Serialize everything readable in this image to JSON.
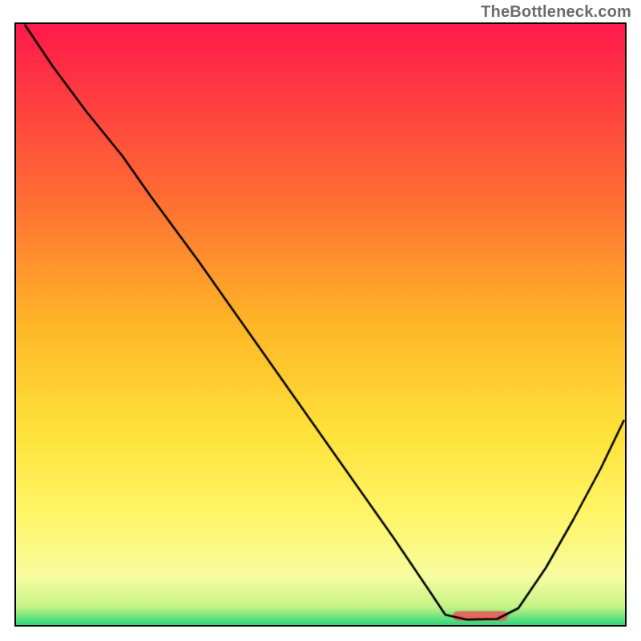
{
  "watermark": "TheBottleneck.com",
  "chart_data": {
    "type": "line",
    "title": "",
    "xlabel": "",
    "ylabel": "",
    "xlim": [
      0,
      1
    ],
    "ylim": [
      0,
      1
    ],
    "background_gradient": {
      "stops": [
        {
          "t": 0.0,
          "color": "#ff1a4b"
        },
        {
          "t": 0.28,
          "color": "#ff6a34"
        },
        {
          "t": 0.5,
          "color": "#ffb728"
        },
        {
          "t": 0.68,
          "color": "#ffe23a"
        },
        {
          "t": 0.82,
          "color": "#fff66a"
        },
        {
          "t": 0.92,
          "color": "#f7fca1"
        },
        {
          "t": 0.97,
          "color": "#c4f486"
        },
        {
          "t": 1.0,
          "color": "#2bd77a"
        }
      ]
    },
    "series": [
      {
        "name": "curve",
        "color": "#000000",
        "width": 2.6,
        "points": [
          {
            "x": 0.015,
            "y": 0.998
          },
          {
            "x": 0.06,
            "y": 0.93
          },
          {
            "x": 0.115,
            "y": 0.855
          },
          {
            "x": 0.175,
            "y": 0.78
          },
          {
            "x": 0.22,
            "y": 0.715
          },
          {
            "x": 0.3,
            "y": 0.605
          },
          {
            "x": 0.38,
            "y": 0.49
          },
          {
            "x": 0.46,
            "y": 0.375
          },
          {
            "x": 0.54,
            "y": 0.26
          },
          {
            "x": 0.62,
            "y": 0.145
          },
          {
            "x": 0.68,
            "y": 0.055
          },
          {
            "x": 0.705,
            "y": 0.017
          },
          {
            "x": 0.74,
            "y": 0.009
          },
          {
            "x": 0.79,
            "y": 0.01
          },
          {
            "x": 0.825,
            "y": 0.028
          },
          {
            "x": 0.87,
            "y": 0.095
          },
          {
            "x": 0.915,
            "y": 0.175
          },
          {
            "x": 0.96,
            "y": 0.26
          },
          {
            "x": 0.998,
            "y": 0.34
          }
        ]
      }
    ],
    "marker": {
      "color": "#e4695d",
      "x_from": 0.725,
      "x_to": 0.8,
      "y": 0.015,
      "thickness_px": 12
    }
  }
}
